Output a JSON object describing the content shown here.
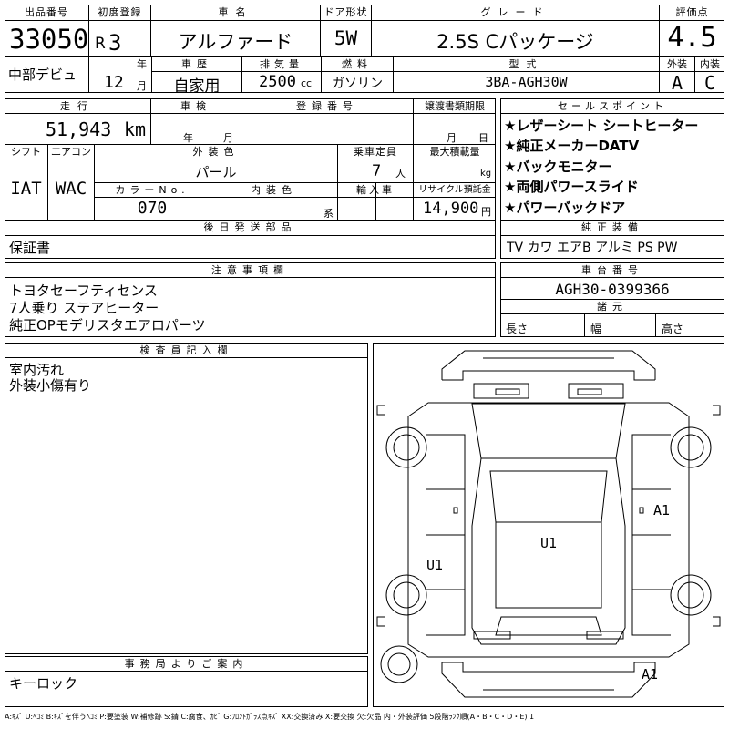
{
  "header": {
    "lot_no_label": "出品番号",
    "lot_no": "33050",
    "debut_label": "中部デビュ",
    "first_reg_label": "初度登録",
    "era": "R",
    "year": "3",
    "year_unit": "年",
    "month": "12",
    "month_unit": "月",
    "car_name_label": "車名",
    "car_name": "アルファード",
    "door_label": "ドア形状",
    "door": "5W",
    "grade_label": "グレード",
    "grade": "2.5S Cパッケージ",
    "score_label": "評価点",
    "score": "4.5",
    "history_label": "車歴",
    "history": "自家用",
    "displacement_label": "排気量",
    "displacement": "2500",
    "displacement_unit": "cc",
    "fuel_label": "燃料",
    "fuel": "ガソリン",
    "model_label": "型式",
    "model": "3BA-AGH30W",
    "exterior_grade_label": "外装",
    "exterior_grade": "A",
    "interior_grade_label": "内装",
    "interior_grade": "C"
  },
  "middle": {
    "mileage_label": "走行",
    "mileage": "51,943",
    "mileage_unit": "km",
    "inspection_label": "車検",
    "inspection_year_unit": "年",
    "inspection_month_unit": "月",
    "reg_no_label": "登録番号",
    "transfer_label": "譲渡書類期限",
    "transfer_month_unit": "月",
    "transfer_day_unit": "日",
    "shift_label": "シフト",
    "shift": "IAT",
    "ac_label": "エアコン",
    "ac": "WAC",
    "exterior_color_label": "外装色",
    "exterior_color": "パール",
    "capacity_label": "乗車定員",
    "capacity": "7",
    "capacity_unit": "人",
    "max_load_label": "最大積載量",
    "max_load_unit": "kg",
    "color_no_label": "カラーNo.",
    "color_no": "070",
    "interior_color_label": "内装色",
    "interior_color_unit": "系",
    "import_label": "輸入車",
    "recycle_label": "リサイクル預託金",
    "recycle": "14,900",
    "recycle_unit": "円",
    "later_parts_label": "後日発送部品",
    "later_parts": "保証書"
  },
  "sales_points": {
    "label": "セールスポイント",
    "items": [
      "★レザーシート シートヒーター",
      "★純正メーカーDATV",
      "★バックモニター",
      "★両側パワースライド",
      "★パワーバックドア"
    ]
  },
  "equipment": {
    "label": "純正装備",
    "value": "TV カワ エアB アルミ PS PW"
  },
  "notes": {
    "label": "注意事項欄",
    "lines": [
      "トヨタセーフティセンス",
      "7人乗り ステアヒーター",
      "純正OPモデリスタエアロパーツ"
    ]
  },
  "chassis": {
    "label": "車台番号",
    "value": "AGH30-0399366",
    "dims_label": "諸元",
    "length_label": "長さ",
    "width_label": "幅",
    "height_label": "高さ"
  },
  "inspector": {
    "label": "検査員記入欄",
    "lines": [
      "室内汚れ",
      "外装小傷有り"
    ]
  },
  "office": {
    "label": "事務局よりご案内",
    "value": "キーロック"
  },
  "diagram": {
    "marks": [
      "A1",
      "U1",
      "U1",
      "A1"
    ]
  },
  "legend": "A:ｷｽﾞ U:ﾍｺﾐ B:ｷｽﾞを伴うﾍｺﾐ P:要塗装 W:補修跡 S:錆 C:腐食、ｶﾋﾞ G:ﾌﾛﾝﾄｶﾞﾗｽ点ｷｽﾞ XX:交換済み X:要交換 欠:欠品 内・外装評価 5段階ﾗﾝｸ順(A・B・C・D・E) 1"
}
